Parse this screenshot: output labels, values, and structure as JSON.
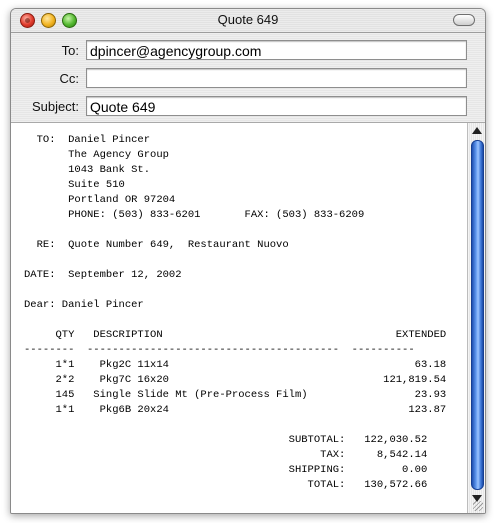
{
  "window": {
    "title": "Quote 649"
  },
  "header": {
    "to_label": "To:",
    "to_value": "dpincer@agencygroup.com",
    "cc_label": "Cc:",
    "cc_value": "",
    "subject_label": "Subject:",
    "subject_value": "Quote 649"
  },
  "message": {
    "to_block": [
      "  TO:  Daniel Pincer",
      "       The Agency Group",
      "       1043 Bank St.",
      "       Suite 510",
      "       Portland OR 97204",
      "       PHONE: (503) 833-6201       FAX: (503) 833-6209"
    ],
    "re_line": "  RE:  Quote Number 649,  Restaurant Nuovo",
    "date_line": "DATE:  September 12, 2002",
    "dear_line": "Dear: Daniel Pincer",
    "table_header": "     QTY   DESCRIPTION                                     EXTENDED",
    "table_rule": "--------  ----------------------------------------  ----------",
    "rows": [
      "     1*1    Pkg2C 11x14                                       63.18",
      "     2*2    Pkg7C 16x20                                  121,819.54",
      "     145   Single Slide Mt (Pre-Process Film)                 23.93",
      "     1*1    Pkg6B 20x24                                      123.87"
    ],
    "totals": [
      "                                          SUBTOTAL:   122,030.52",
      "                                               TAX:     8,542.14",
      "                                          SHIPPING:         0.00",
      "                                             TOTAL:   130,572.66"
    ]
  }
}
